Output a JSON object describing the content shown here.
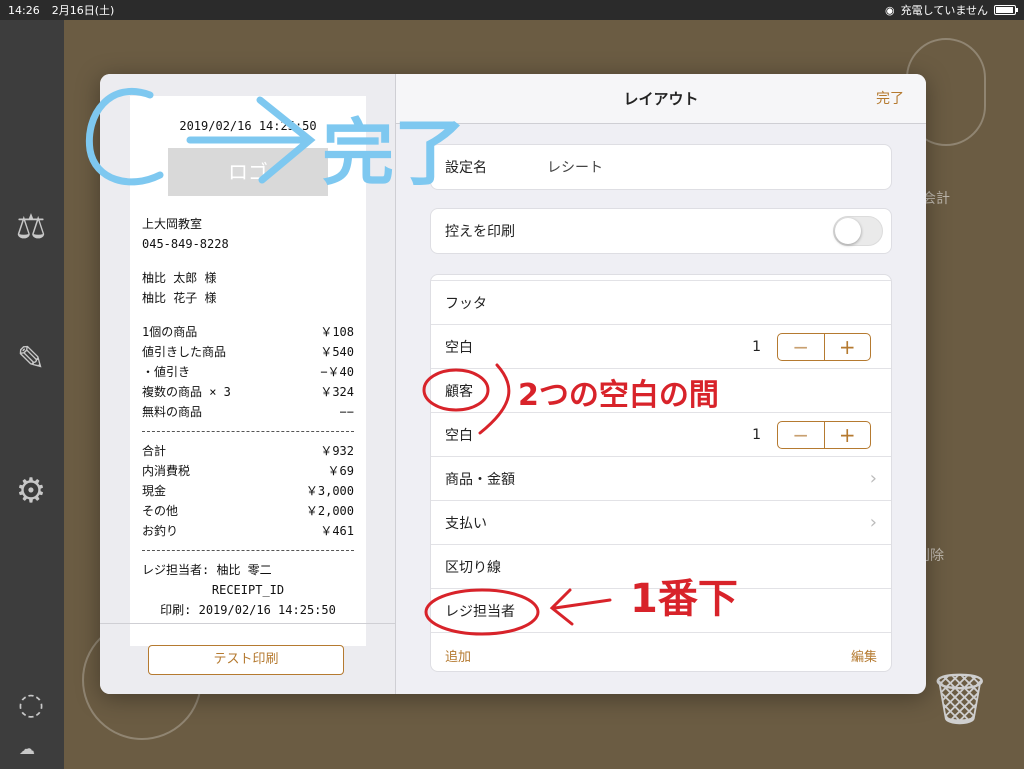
{
  "status_bar": {
    "time": "14:26",
    "date": "2月16日(土)",
    "charging": "充電していません"
  },
  "background": {
    "label_total": "会計",
    "label_delete": "削除"
  },
  "modal": {
    "title": "レイアウト",
    "done": "完了",
    "receipt": {
      "datetime": "2019/02/16 14:25:50",
      "logo": "ロゴ",
      "store_name": "上大岡教室",
      "store_phone": "045-849-8228",
      "customers": [
        "柚比 太郎 様",
        "柚比 花子 様"
      ],
      "items": [
        {
          "name": "1個の商品",
          "price": "￥108"
        },
        {
          "name": "値引きした商品",
          "price": "￥540"
        },
        {
          "name": "・値引き",
          "price": "−￥40"
        },
        {
          "name": "複数の商品 × 3",
          "price": "￥324"
        },
        {
          "name": "無料の商品",
          "price": "−−"
        }
      ],
      "totals": [
        {
          "name": "合計",
          "price": "￥932"
        },
        {
          "name": "内消費税",
          "price": "￥69"
        },
        {
          "name": "現金",
          "price": "￥3,000"
        },
        {
          "name": "その他",
          "price": "￥2,000"
        },
        {
          "name": "お釣り",
          "price": "￥461"
        }
      ],
      "cashier": "レジ担当者: 柚比 零二",
      "receipt_id": "RECEIPT_ID",
      "printed": "印刷: 2019/02/16 14:25:50"
    },
    "test_print": "テスト印刷",
    "setting_name_label": "設定名",
    "setting_name_value": "レシート",
    "print_copy_label": "控えを印刷",
    "layout_rows": [
      {
        "label": "フッタ"
      },
      {
        "label": "空白",
        "count": "1"
      },
      {
        "label": "顧客"
      },
      {
        "label": "空白",
        "count": "1"
      },
      {
        "label": "商品・金額"
      },
      {
        "label": "支払い"
      },
      {
        "label": "区切り線"
      },
      {
        "label": "レジ担当者"
      }
    ],
    "add_label": "追加",
    "edit_label": "編集",
    "stepper_minus": "−",
    "stepper_plus": "+"
  },
  "annotations": {
    "done_note": "完了",
    "between_note": "2つの空白の間",
    "bottom_note": "1番下"
  },
  "colors": {
    "accent": "#b57a30",
    "annotation_blue": "#7ec8f0",
    "annotation_red": "#d8232a"
  }
}
